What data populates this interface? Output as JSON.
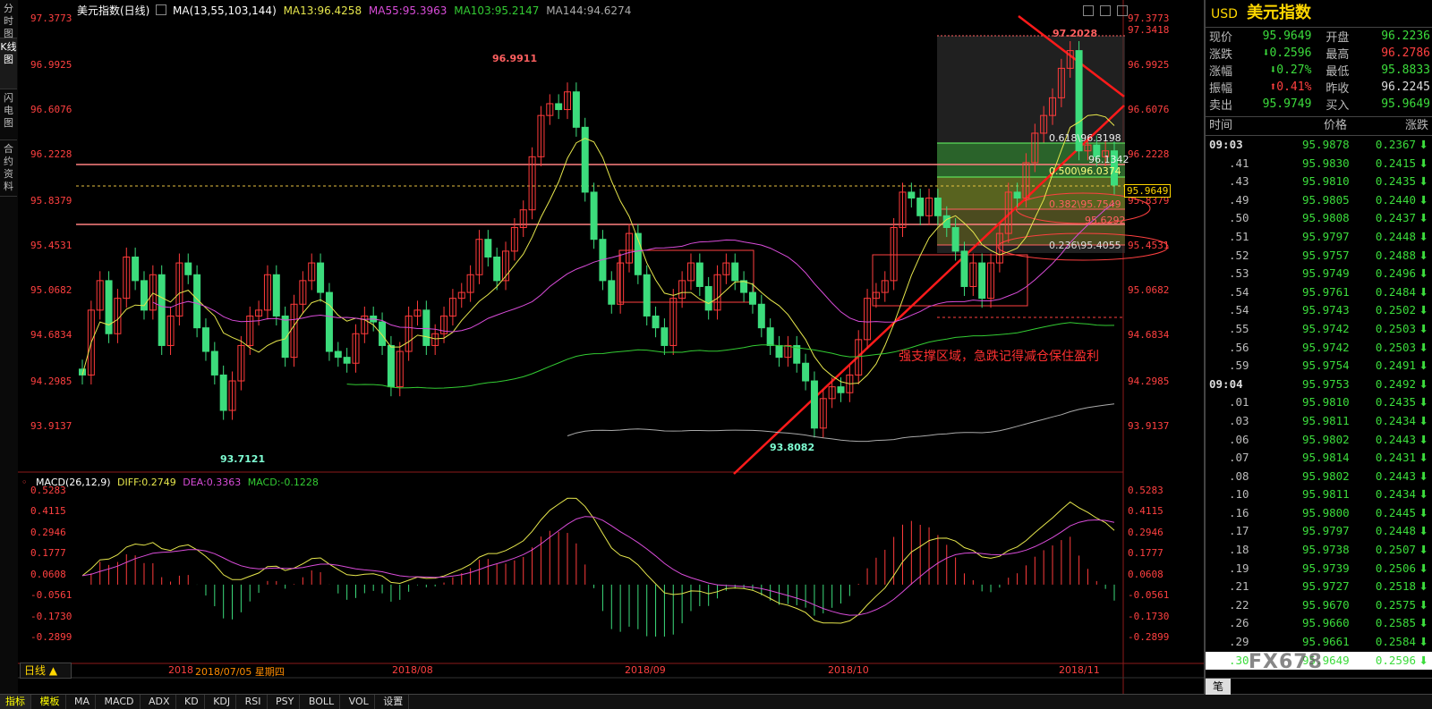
{
  "sidebar": {
    "tabs": [
      {
        "label": "分时图"
      },
      {
        "label": "K线图"
      },
      {
        "label": "闪电图"
      },
      {
        "label": "合约资料"
      }
    ]
  },
  "chart": {
    "header": {
      "title": "美元指数(日线)",
      "ma_params": "MA(13,55,103,144)",
      "ma13": "MA13:96.4258",
      "ma55": "MA55:95.3963",
      "ma103": "MA103:95.2147",
      "ma144": "MA144:94.6274"
    },
    "macd_header": {
      "params": "MACD(26,12,9)",
      "diff": "DIFF:0.2749",
      "dea": "DEA:0.3363",
      "macd": "MACD:-0.1228"
    },
    "price_axis": [
      "97.3773",
      "96.9925",
      "96.6076",
      "96.2228",
      "95.8379",
      "95.4531",
      "95.0682",
      "94.6834",
      "94.2985",
      "93.9137"
    ],
    "macd_axis": [
      "0.5283",
      "0.4115",
      "0.2946",
      "0.1777",
      "0.0608",
      "-0.0561",
      "-0.1730",
      "-0.2899"
    ],
    "price_axis_extra": "97.3418",
    "current_price_tag": "95.9649",
    "annotations": {
      "high_aug": "96.9911",
      "low_jul": "93.7121",
      "low_sep": "93.8082",
      "high_nov": "97.2028",
      "fib_618": "0.618\\96.3198",
      "fib_500": "0.500\\96.0374",
      "fib_382": "0.382\\95.7549",
      "fib_236": "0.236\\95.4055",
      "label_9613": "96.1342",
      "label_9562": "95.6292",
      "support_text": "强支撑区域，急跌记得减仓保住盈利"
    },
    "date_axis": {
      "cursor_date": "2018/07/05 星期四",
      "labels": [
        "2018",
        "2018/08",
        "2018/09",
        "2018/10",
        "2018/11"
      ]
    },
    "period_label": "日线"
  },
  "toolbar": {
    "items": [
      "指标",
      "模板",
      "MA",
      "MACD",
      "ADX",
      "KD",
      "KDJ",
      "RSI",
      "PSY",
      "BOLL",
      "VOL",
      "设置"
    ]
  },
  "quote": {
    "code": "USD",
    "name": "美元指数",
    "rows": [
      {
        "l1": "现价",
        "v1": "95.9649",
        "l2": "开盘",
        "v2": "96.2236"
      },
      {
        "l1": "涨跌",
        "v1": "0.2596",
        "l2": "最高",
        "v2": "96.2786"
      },
      {
        "l1": "涨幅",
        "v1": "0.27%",
        "l2": "最低",
        "v2": "95.8833"
      },
      {
        "l1": "振幅",
        "v1": "0.41%",
        "l2": "昨收",
        "v2": "96.2245"
      },
      {
        "l1": "卖出",
        "v1": "95.9749",
        "l2": "买入",
        "v2": "95.9649"
      }
    ],
    "tick_header": {
      "time": "时间",
      "price": "价格",
      "change": "涨跌"
    },
    "ticks": [
      {
        "t": "09:03",
        "p": "95.9878",
        "c": "0.2367"
      },
      {
        "t": ".41",
        "p": "95.9830",
        "c": "0.2415"
      },
      {
        "t": ".43",
        "p": "95.9810",
        "c": "0.2435"
      },
      {
        "t": ".49",
        "p": "95.9805",
        "c": "0.2440"
      },
      {
        "t": ".50",
        "p": "95.9808",
        "c": "0.2437"
      },
      {
        "t": ".51",
        "p": "95.9797",
        "c": "0.2448"
      },
      {
        "t": ".52",
        "p": "95.9757",
        "c": "0.2488"
      },
      {
        "t": ".53",
        "p": "95.9749",
        "c": "0.2496"
      },
      {
        "t": ".54",
        "p": "95.9761",
        "c": "0.2484"
      },
      {
        "t": ".54",
        "p": "95.9743",
        "c": "0.2502"
      },
      {
        "t": ".55",
        "p": "95.9742",
        "c": "0.2503"
      },
      {
        "t": ".56",
        "p": "95.9742",
        "c": "0.2503"
      },
      {
        "t": ".59",
        "p": "95.9754",
        "c": "0.2491"
      },
      {
        "t": "09:04",
        "p": "95.9753",
        "c": "0.2492"
      },
      {
        "t": ".01",
        "p": "95.9810",
        "c": "0.2435"
      },
      {
        "t": ".03",
        "p": "95.9811",
        "c": "0.2434"
      },
      {
        "t": ".06",
        "p": "95.9802",
        "c": "0.2443"
      },
      {
        "t": ".07",
        "p": "95.9814",
        "c": "0.2431"
      },
      {
        "t": ".08",
        "p": "95.9802",
        "c": "0.2443"
      },
      {
        "t": ".10",
        "p": "95.9811",
        "c": "0.2434"
      },
      {
        "t": ".16",
        "p": "95.9800",
        "c": "0.2445"
      },
      {
        "t": ".17",
        "p": "95.9797",
        "c": "0.2448"
      },
      {
        "t": ".18",
        "p": "95.9738",
        "c": "0.2507"
      },
      {
        "t": ".19",
        "p": "95.9739",
        "c": "0.2506"
      },
      {
        "t": ".21",
        "p": "95.9727",
        "c": "0.2518"
      },
      {
        "t": ".22",
        "p": "95.9670",
        "c": "0.2575"
      },
      {
        "t": ".26",
        "p": "95.9660",
        "c": "0.2585"
      },
      {
        "t": ".29",
        "p": "95.9661",
        "c": "0.2584"
      },
      {
        "t": ".30",
        "p": "95.9649",
        "c": "0.2596"
      }
    ],
    "footer_label": "笔",
    "watermark": "FX678"
  },
  "colors": {
    "up": "#ff3b3b",
    "down": "#3cdc7c",
    "ma13": "#e6e64c",
    "ma55": "#d94cd9",
    "ma103": "#33cc33",
    "ma144": "#aaaaaa",
    "axis_text": "#ff4040"
  }
}
